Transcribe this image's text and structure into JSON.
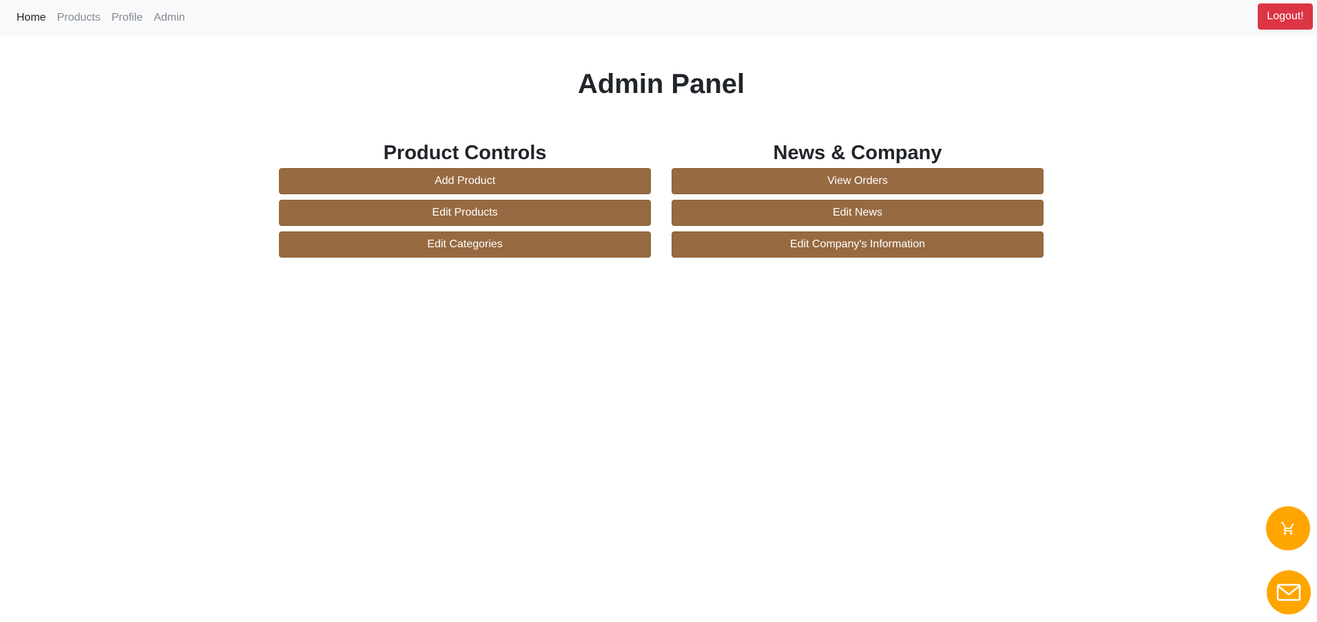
{
  "nav": {
    "items": [
      {
        "label": "Home"
      },
      {
        "label": "Products"
      },
      {
        "label": "Profile"
      },
      {
        "label": "Admin"
      }
    ],
    "logout_label": "Logout!"
  },
  "page": {
    "title": "Admin Panel"
  },
  "product_controls": {
    "title": "Product Controls",
    "buttons": [
      {
        "label": "Add Product"
      },
      {
        "label": "Edit Products"
      },
      {
        "label": "Edit Categories"
      }
    ]
  },
  "news_company": {
    "title": "News & Company",
    "buttons": [
      {
        "label": "View Orders"
      },
      {
        "label": "Edit News"
      },
      {
        "label": "Edit Company's Information"
      }
    ]
  },
  "floating": {
    "cart_icon": "cart-icon",
    "mail_icon": "mail-icon"
  },
  "colors": {
    "navbar_bg": "#f8f9fa",
    "logout_bg": "#dc3545",
    "action_button_bg": "#976a41",
    "fab_bg": "#ffa500"
  }
}
